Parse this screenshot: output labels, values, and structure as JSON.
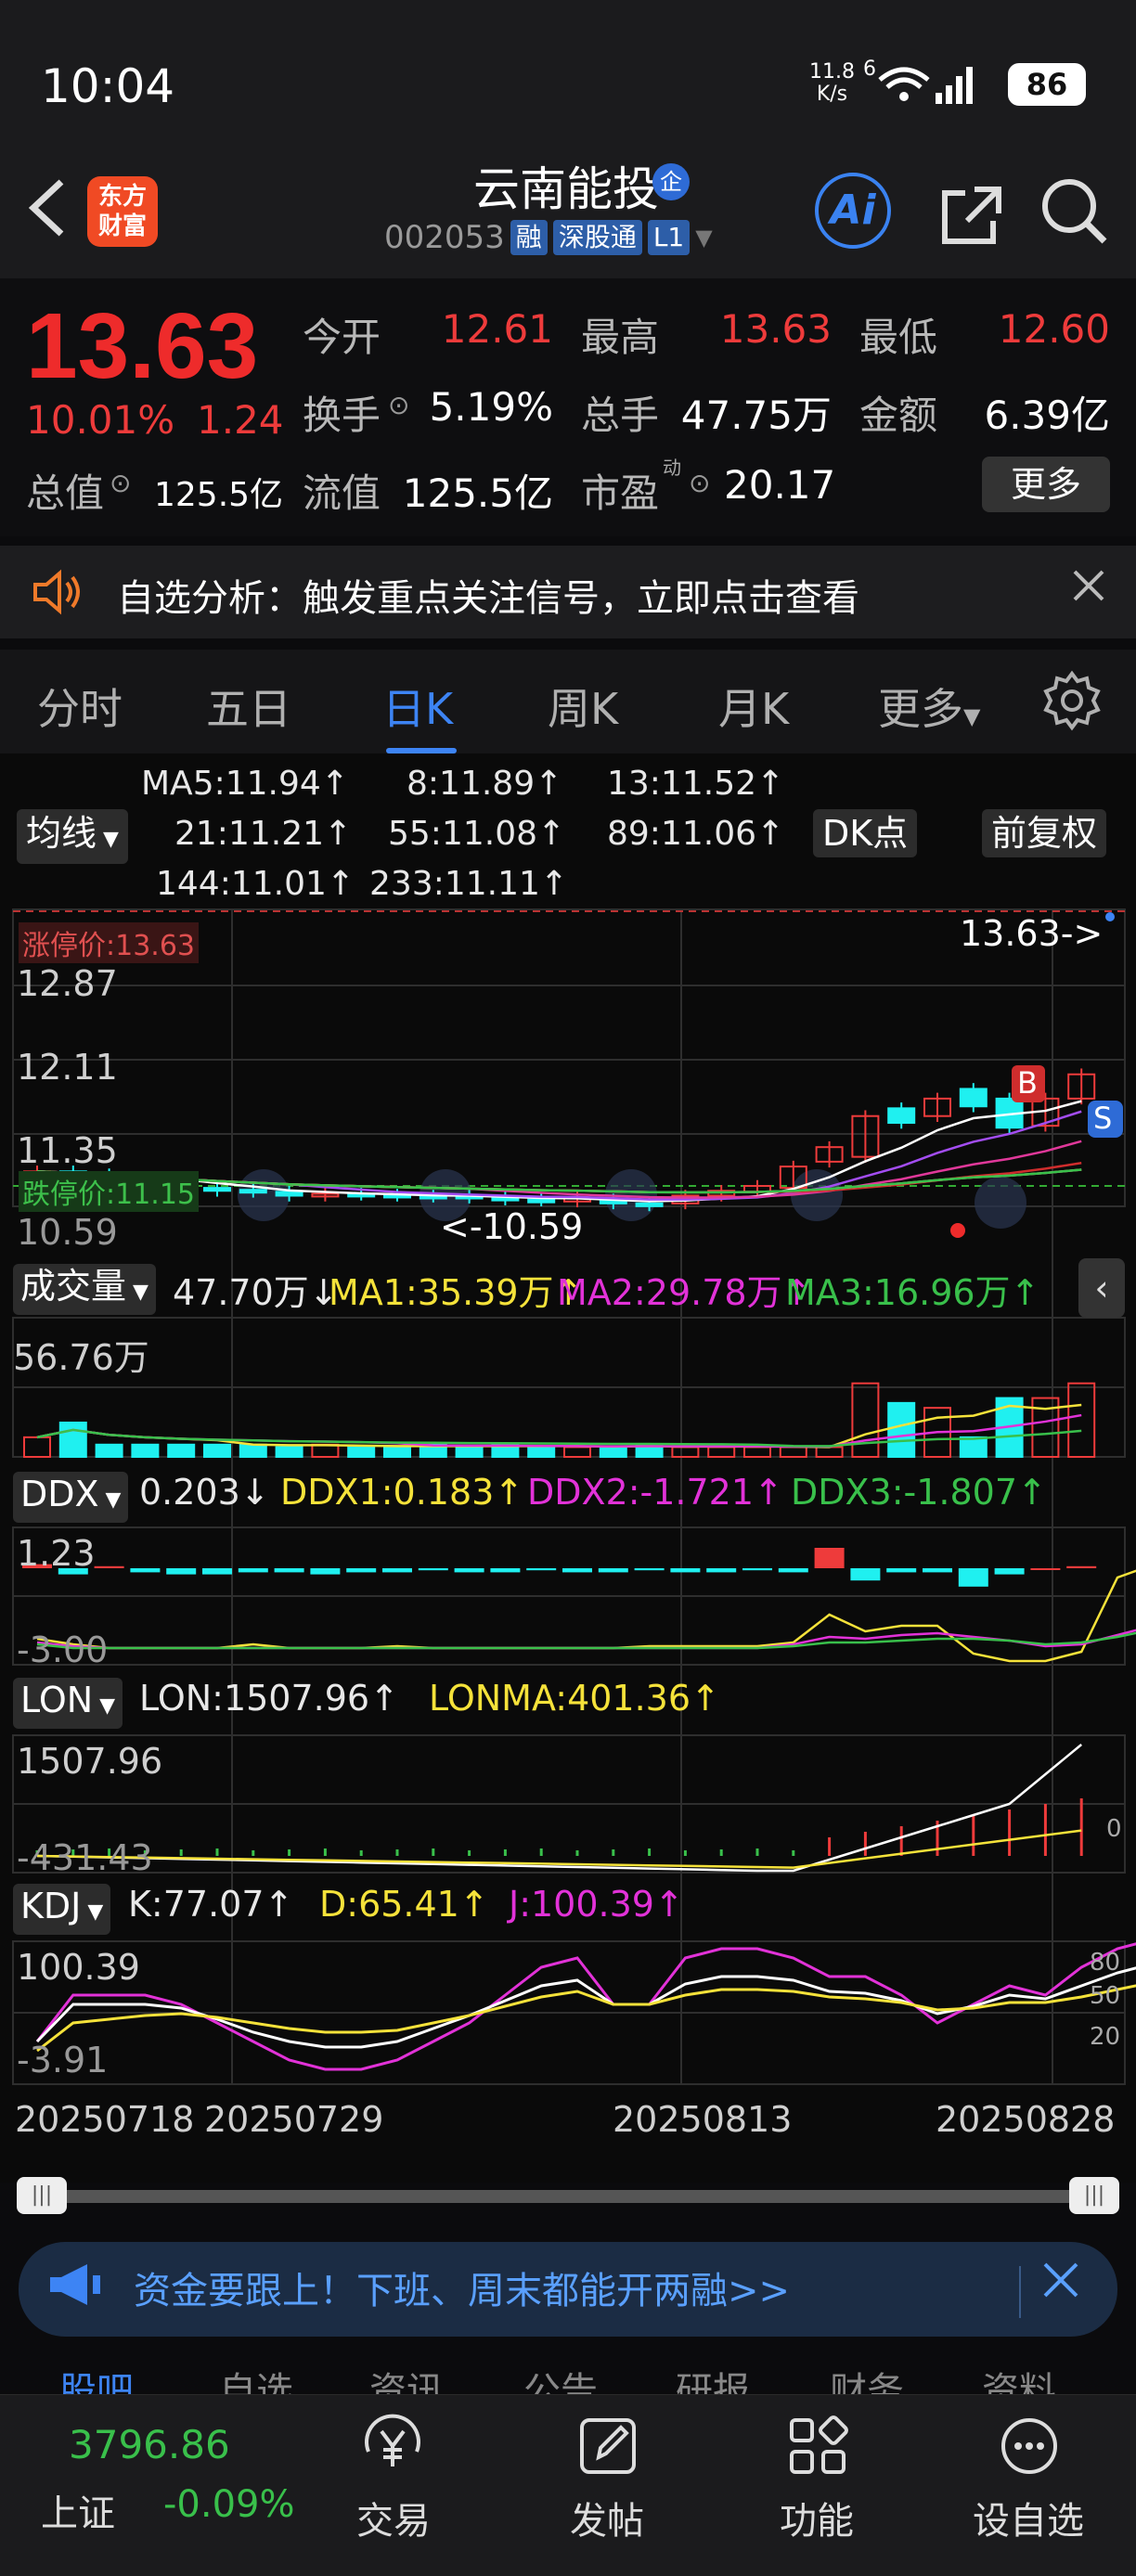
{
  "status_bar": {
    "time": "10:04",
    "net_speed": "11.8",
    "net_unit": "K/s",
    "net_gen": "6",
    "battery": "86"
  },
  "header": {
    "back_icon": "chevron-left-icon",
    "logo": [
      "东方",
      "财富"
    ],
    "name": "云南能投",
    "badge": "企",
    "code": "002053",
    "tags": [
      "融",
      "深股通",
      "L1"
    ],
    "ai_label": "Ai"
  },
  "quote": {
    "price": "13.63",
    "change_pct": "10.01%",
    "change": "1.24",
    "rows": [
      {
        "l1": "今开",
        "v1": "12.61",
        "c1": "red",
        "l2": "最高",
        "v2": "13.63",
        "c2": "red",
        "l3": "最低",
        "v3": "12.60",
        "c3": "red"
      },
      {
        "l1": "换手",
        "v1": "5.19%",
        "c1": "white",
        "l2": "总手",
        "v2": "47.75万",
        "c2": "white",
        "l3": "金额",
        "v3": "6.39亿",
        "c3": "white"
      },
      {
        "l1": "总值",
        "v1": "125.5亿",
        "c1": "white",
        "l2": "流值",
        "v2": "125.5亿",
        "c2": "white",
        "l3": "市盈",
        "v3": "20.17",
        "c3": "white"
      }
    ],
    "pe_sup": "动",
    "more": "更多"
  },
  "alert": {
    "text": "自选分析：触发重点关注信号，立即点击查看"
  },
  "tabs": [
    "分时",
    "五日",
    "日K",
    "周K",
    "月K",
    "更多"
  ],
  "active_tab": 2,
  "ma": {
    "selector": "均线",
    "items": [
      {
        "label": "MA5:11.94↑",
        "color": "#ffffff"
      },
      {
        "label": "8:11.89↑",
        "color": "#a34df2"
      },
      {
        "label": "13:11.52↑",
        "color": "#e0389a"
      },
      {
        "label": "21:11.21↑",
        "color": "#cf2d2d"
      },
      {
        "label": "55:11.08↑",
        "color": "#f5b48a"
      },
      {
        "label": "89:11.06↑",
        "color": "#4a5ee6"
      },
      {
        "label": "144:11.01↑",
        "color": "#39c04b"
      },
      {
        "label": "233:11.11↑",
        "color": "#e6e6e6"
      }
    ],
    "dk_button": "DK点",
    "adjust_button": "前复权"
  },
  "kline": {
    "y_labels": [
      "13.63",
      "12.87",
      "12.11",
      "11.35",
      "10.59"
    ],
    "limit_up": "涨停价:13.63",
    "limit_down": "跌停价:11.15",
    "last_price_marker": "13.63->",
    "min_marker": "<-10.59",
    "buy_marker": "B",
    "sell_marker": "S"
  },
  "volume": {
    "selector": "成交量",
    "value": "47.70万↓",
    "ma1": "MA1:35.39万↑",
    "ma2": "MA2:29.78万↑",
    "ma3": "MA3:16.96万↑",
    "max_label": "56.76万"
  },
  "ddx": {
    "selector": "DDX",
    "value": "0.203↓",
    "ddx1": "DDX1:0.183↑",
    "ddx2": "DDX2:-1.721↑",
    "ddx3": "DDX3:-1.807↑",
    "top": "1.23",
    "bottom": "-3.00"
  },
  "lon": {
    "selector": "LON",
    "value": "LON:1507.96↑",
    "lonma": "LONMA:401.36↑",
    "top": "1507.96",
    "bottom": "-431.43",
    "zero": "0"
  },
  "kdj": {
    "selector": "KDJ",
    "k": "K:77.07↑",
    "d": "D:65.41↑",
    "j": "J:100.39↑",
    "top": "100.39",
    "bottom": "-3.91",
    "levels": [
      "80",
      "50",
      "20"
    ]
  },
  "dates": [
    "20250718",
    "20250729",
    "20250813",
    "20250828"
  ],
  "promo": {
    "text": "资金要跟上！下班、周末都能开两融>>"
  },
  "bottom_peek_tabs": [
    "股吧",
    "自选",
    "资讯",
    "公告",
    "研报",
    "财务",
    "资料"
  ],
  "bottom_nav": {
    "index_value": "3796.86",
    "index_name": "上证",
    "index_pct": "-0.09%",
    "items": [
      {
        "label": "交易",
        "icon": "yen-icon"
      },
      {
        "label": "发帖",
        "icon": "edit-icon"
      },
      {
        "label": "功能",
        "icon": "grid-icon"
      },
      {
        "label": "设自选",
        "icon": "more-icon"
      }
    ]
  },
  "colors": {
    "up": "#ee3b3b",
    "down": "#1ff0f0",
    "accent": "#3d84f4",
    "ma_yellow": "#f5e23a",
    "ma_magenta": "#e232d8",
    "ma_green": "#39c04b"
  }
}
